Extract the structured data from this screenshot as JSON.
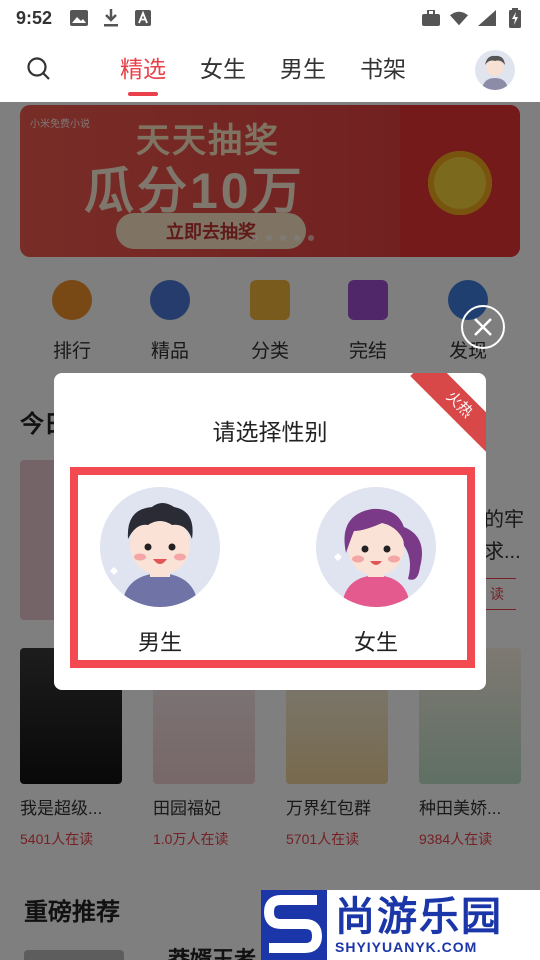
{
  "status": {
    "time": "9:52"
  },
  "nav": {
    "tabs": [
      "精选",
      "女生",
      "男生",
      "书架"
    ],
    "active_tab": 0
  },
  "banner": {
    "tag": "小米免费小说",
    "line1": "天天抽奖",
    "line2": "瓜分10万",
    "cta": "立即去抽奖"
  },
  "categories": [
    "排行",
    "精品",
    "分类",
    "完结",
    "发现"
  ],
  "section": {
    "title_partial": "今日",
    "side_text_1": "的牢",
    "side_text_2": "求...",
    "side_button": "读"
  },
  "books": [
    {
      "title": "我是超级...",
      "readers": "5401人在读"
    },
    {
      "title": "田园福妃",
      "readers": "1.0万人在读"
    },
    {
      "title": "万界红包群",
      "readers": "5701人在读"
    },
    {
      "title": "种田美娇...",
      "readers": "9384人在读"
    }
  ],
  "section2": {
    "title": "重磅推荐",
    "peek": "莽婿王者"
  },
  "dialog": {
    "title": "请选择性别",
    "ribbon": "火热",
    "options": [
      {
        "label": "男生"
      },
      {
        "label": "女生"
      }
    ]
  },
  "watermark": {
    "big": "尚游乐园",
    "small": "SHYIYUANYK.COM"
  },
  "colors": {
    "accent": "#e9404a",
    "highlight_border": "#f34a52",
    "watermark": "#1b36a8"
  }
}
